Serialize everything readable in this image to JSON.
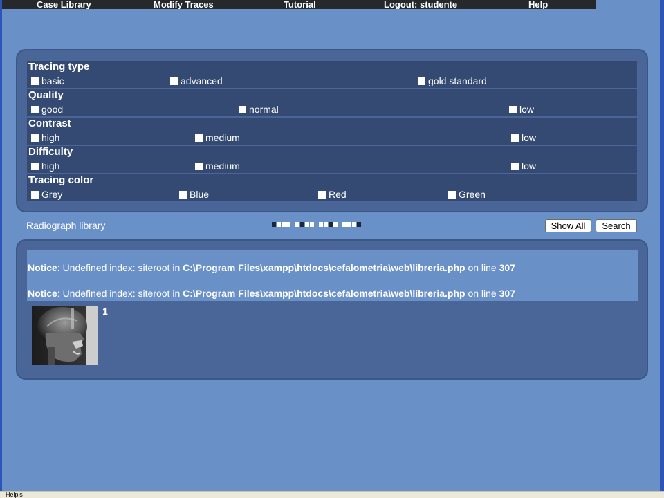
{
  "menu": {
    "items": [
      "Case Library",
      "Modify Traces",
      "Tutorial",
      "Logout: studente",
      "Help"
    ]
  },
  "filters": {
    "tracing_type": {
      "title": "Tracing type",
      "options": [
        "basic",
        "advanced",
        "gold standard"
      ]
    },
    "quality": {
      "title": "Quality",
      "options": [
        "good",
        "normal",
        "low"
      ]
    },
    "contrast": {
      "title": "Contrast",
      "options": [
        "high",
        "medium",
        "low"
      ]
    },
    "difficulty": {
      "title": "Difficulty",
      "options": [
        "high",
        "medium",
        "low"
      ]
    },
    "tracing_color": {
      "title": "Tracing color",
      "options": [
        "Grey",
        "Blue",
        "Red",
        "Green"
      ]
    }
  },
  "library": {
    "title": "Radiograph library",
    "pages": [
      1,
      2,
      3,
      4
    ],
    "current_page": 1,
    "show_all_label": "Show All",
    "search_label": "Search"
  },
  "notices": [
    {
      "label": "Notice",
      "message": ": Undefined index: siteroot in ",
      "path": "C:\\Program Files\\xampp\\htdocs\\cefalometria\\web\\libreria.php",
      "line_text": " on line ",
      "line": "307"
    },
    {
      "label": "Notice",
      "message": ": Undefined index: siteroot in ",
      "path": "C:\\Program Files\\xampp\\htdocs\\cefalometria\\web\\libreria.php",
      "line_text": " on line ",
      "line": "307"
    }
  ],
  "results": [
    {
      "number": "1",
      "image": "cephalometric-radiograph"
    }
  ],
  "status_bar": {
    "text": "Help's"
  },
  "colors": {
    "background": "#6a90c8",
    "panel": "#4a6699",
    "group": "#344a72",
    "menu": "#26282c"
  }
}
